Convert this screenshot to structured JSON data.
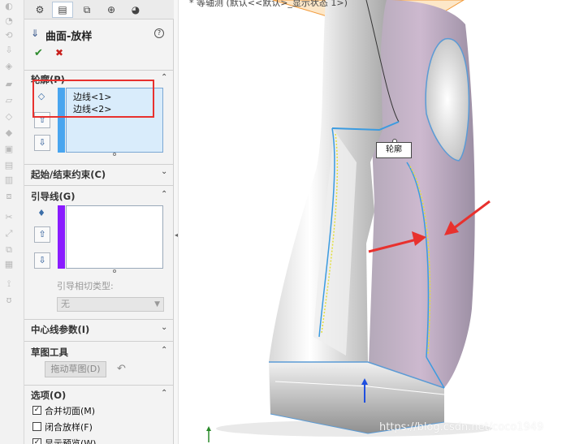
{
  "feature": {
    "title": "曲面-放样"
  },
  "sections": {
    "profile": {
      "title": "轮廓(P)",
      "items": [
        "边线<1>",
        "边线<2>"
      ]
    },
    "constraints": {
      "title": "起始/结束约束(C)"
    },
    "guides": {
      "title": "引导线(G)",
      "tangency_label": "引导相切类型:",
      "tangency_value": "无"
    },
    "centerline": {
      "title": "中心线参数(I)"
    },
    "sketch_tools": {
      "title": "草图工具",
      "drag_button": "拖动草图(D)"
    },
    "options": {
      "title": "选项(O)",
      "checkboxes": [
        {
          "label": "合并切面(M)",
          "checked": true
        },
        {
          "label": "闭合放样(F)",
          "checked": false
        },
        {
          "label": "显示预览(W)",
          "checked": true
        }
      ]
    }
  },
  "viewport": {
    "top_note": "* 等轴测 (默认<<默认>_显示状态 1>)",
    "callout": "轮廓",
    "watermark": "https://blog.csdn.net/coco1949"
  },
  "colors": {
    "accent": "#3b9be0",
    "profile_bar": "#49a5ef",
    "guide_bar": "#8a1bff",
    "annotation": "#e8312e"
  },
  "icons": {
    "ok": "checkmark-icon",
    "cancel": "x-icon",
    "up": "arrow-up-icon",
    "down": "arrow-down-icon"
  }
}
